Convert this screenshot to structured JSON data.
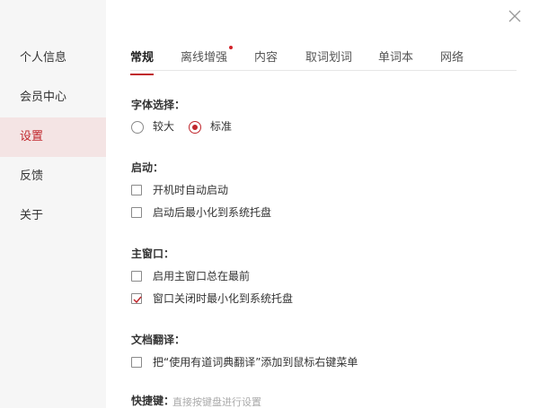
{
  "sidebar": {
    "items": [
      {
        "label": "个人信息"
      },
      {
        "label": "会员中心"
      },
      {
        "label": "设置"
      },
      {
        "label": "反馈"
      },
      {
        "label": "关于"
      }
    ],
    "active_index": 2
  },
  "tabs": [
    {
      "label": "常规"
    },
    {
      "label": "离线增强"
    },
    {
      "label": "内容"
    },
    {
      "label": "取词划词"
    },
    {
      "label": "单词本"
    },
    {
      "label": "网络"
    }
  ],
  "font_section": {
    "title": "字体选择：",
    "options": [
      {
        "label": "较大",
        "selected": false
      },
      {
        "label": "标准",
        "selected": true
      }
    ]
  },
  "startup_section": {
    "title": "启动：",
    "options": [
      {
        "label": "开机时自动启动",
        "checked": false
      },
      {
        "label": "启动后最小化到系统托盘",
        "checked": false
      }
    ]
  },
  "main_window_section": {
    "title": "主窗口：",
    "options": [
      {
        "label": "启用主窗口总在最前",
        "checked": false
      },
      {
        "label": "窗口关闭时最小化到系统托盘",
        "checked": true
      }
    ]
  },
  "doc_translate_section": {
    "title": "文档翻译：",
    "options": [
      {
        "label": "把“使用有道词典翻译”添加到鼠标右键菜单",
        "checked": false
      }
    ]
  },
  "shortcut_section": {
    "title": "快捷键：",
    "placeholder": "直接按键盘进行设置"
  },
  "colors": {
    "accent": "#c0262c",
    "sidebar_bg": "#f6f6f6",
    "sidebar_active_bg": "#f4e4e4"
  }
}
